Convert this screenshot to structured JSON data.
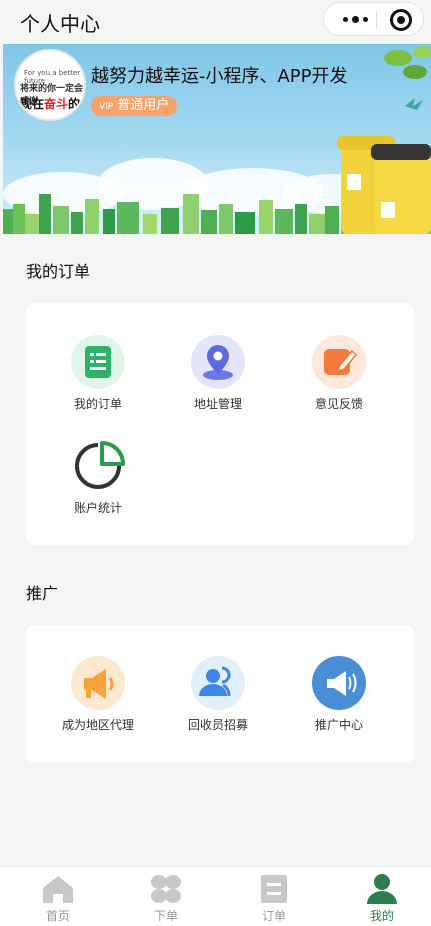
{
  "nav": {
    "title": "个人中心"
  },
  "header": {
    "title": "越努力越幸运-小程序、APP开发",
    "vip_tag": "VIP",
    "member_level": "普通用户",
    "avatar_text": {
      "line1": "For you a better future",
      "line2": "将来的你一定会感谢",
      "line3a": "现在",
      "line3b": "奋斗",
      "line3c": "的你"
    }
  },
  "orders_section": {
    "title": "我的订单",
    "items": [
      {
        "label": "我的订单",
        "icon": "order-list-icon"
      },
      {
        "label": "地址管理",
        "icon": "location-pin-icon"
      },
      {
        "label": "意见反馈",
        "icon": "edit-icon"
      },
      {
        "label": "账户统计",
        "icon": "pie-chart-icon"
      }
    ]
  },
  "promo_section": {
    "title": "推广",
    "items": [
      {
        "label": "成为地区代理",
        "icon": "megaphone-icon"
      },
      {
        "label": "回收员招募",
        "icon": "users-icon"
      },
      {
        "label": "推广中心",
        "icon": "loudspeaker-icon"
      }
    ]
  },
  "tabbar": {
    "items": [
      {
        "label": "首页",
        "icon": "home-icon",
        "active": false
      },
      {
        "label": "下单",
        "icon": "grid-icon",
        "active": false
      },
      {
        "label": "订单",
        "icon": "document-icon",
        "active": false
      },
      {
        "label": "我的",
        "icon": "user-icon",
        "active": true
      }
    ]
  },
  "colors": {
    "accent_green": "#2e7d4f",
    "vip_orange": "#f6a36a",
    "inactive_gray": "#999999"
  }
}
